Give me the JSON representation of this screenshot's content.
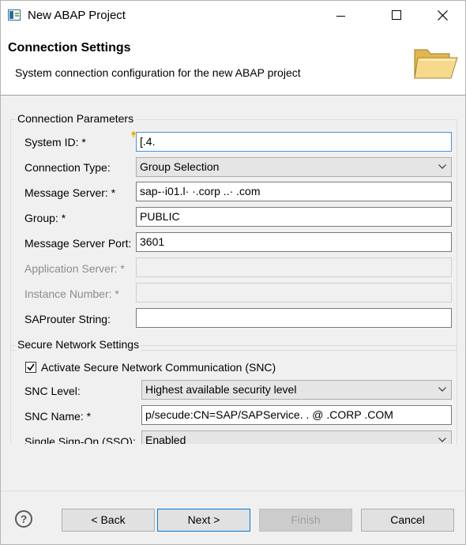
{
  "window": {
    "title": "New ABAP Project"
  },
  "header": {
    "title": "Connection Settings",
    "description": "System connection configuration for the new ABAP project"
  },
  "connection_parameters": {
    "legend": "Connection Parameters",
    "system_id": {
      "label": "System ID: *",
      "value": "[.4."
    },
    "connection_type": {
      "label": "Connection Type:",
      "value": "Group Selection"
    },
    "message_server": {
      "label": "Message Server: *",
      "value": "sap-·i01.l· ·.corp ..· .com"
    },
    "group": {
      "label": "Group: *",
      "value": "PUBLIC"
    },
    "message_server_port": {
      "label": "Message Server Port:",
      "value": "3601"
    },
    "application_server": {
      "label": "Application Server: *",
      "value": ""
    },
    "instance_number": {
      "label": "Instance Number: *",
      "value": ""
    },
    "saprouter_string": {
      "label": "SAProuter String:",
      "value": ""
    }
  },
  "secure_network": {
    "legend": "Secure Network Settings",
    "activate_snc": {
      "label": "Activate Secure Network Communication (SNC)",
      "checked": true
    },
    "snc_level": {
      "label": "SNC Level:",
      "value": "Highest available security level"
    },
    "snc_name": {
      "label": "SNC Name: *",
      "value": "p/secude:CN=SAP/SAPService.  . @       .CORP     .COM"
    },
    "sso": {
      "label": "Single Sign-On (SSO):",
      "value": "Enabled"
    }
  },
  "footer": {
    "back": "< Back",
    "next": "Next >",
    "finish": "Finish",
    "cancel": "Cancel"
  },
  "colors": {
    "focus_border": "#4a90d9",
    "primary_button_border": "#0078d7",
    "disabled_text": "#8c8c8c"
  }
}
